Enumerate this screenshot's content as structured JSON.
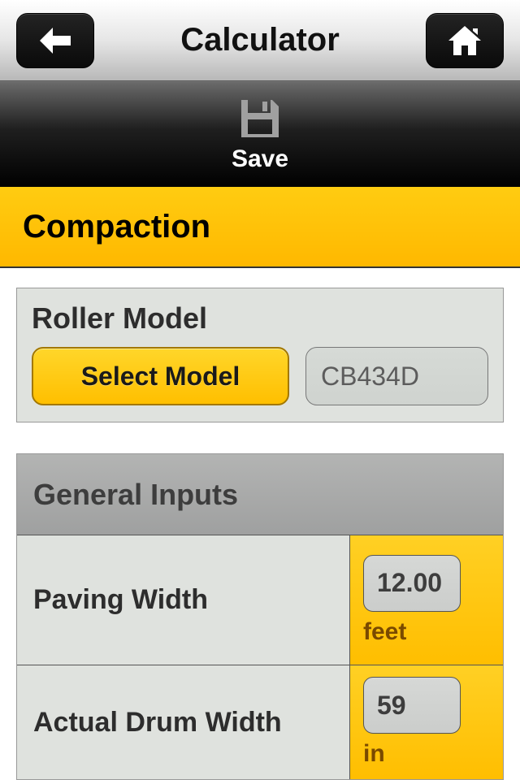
{
  "navbar": {
    "title": "Calculator"
  },
  "savebar": {
    "label": "Save"
  },
  "section": {
    "title": "Compaction"
  },
  "roller": {
    "label": "Roller Model",
    "select_label": "Select Model",
    "value": "CB434D"
  },
  "inputs": {
    "header": "General Inputs",
    "rows": [
      {
        "label": "Paving Width",
        "value": "12.00",
        "unit": "feet"
      },
      {
        "label": "Actual Drum Width",
        "value": "59",
        "unit": "in"
      }
    ]
  }
}
